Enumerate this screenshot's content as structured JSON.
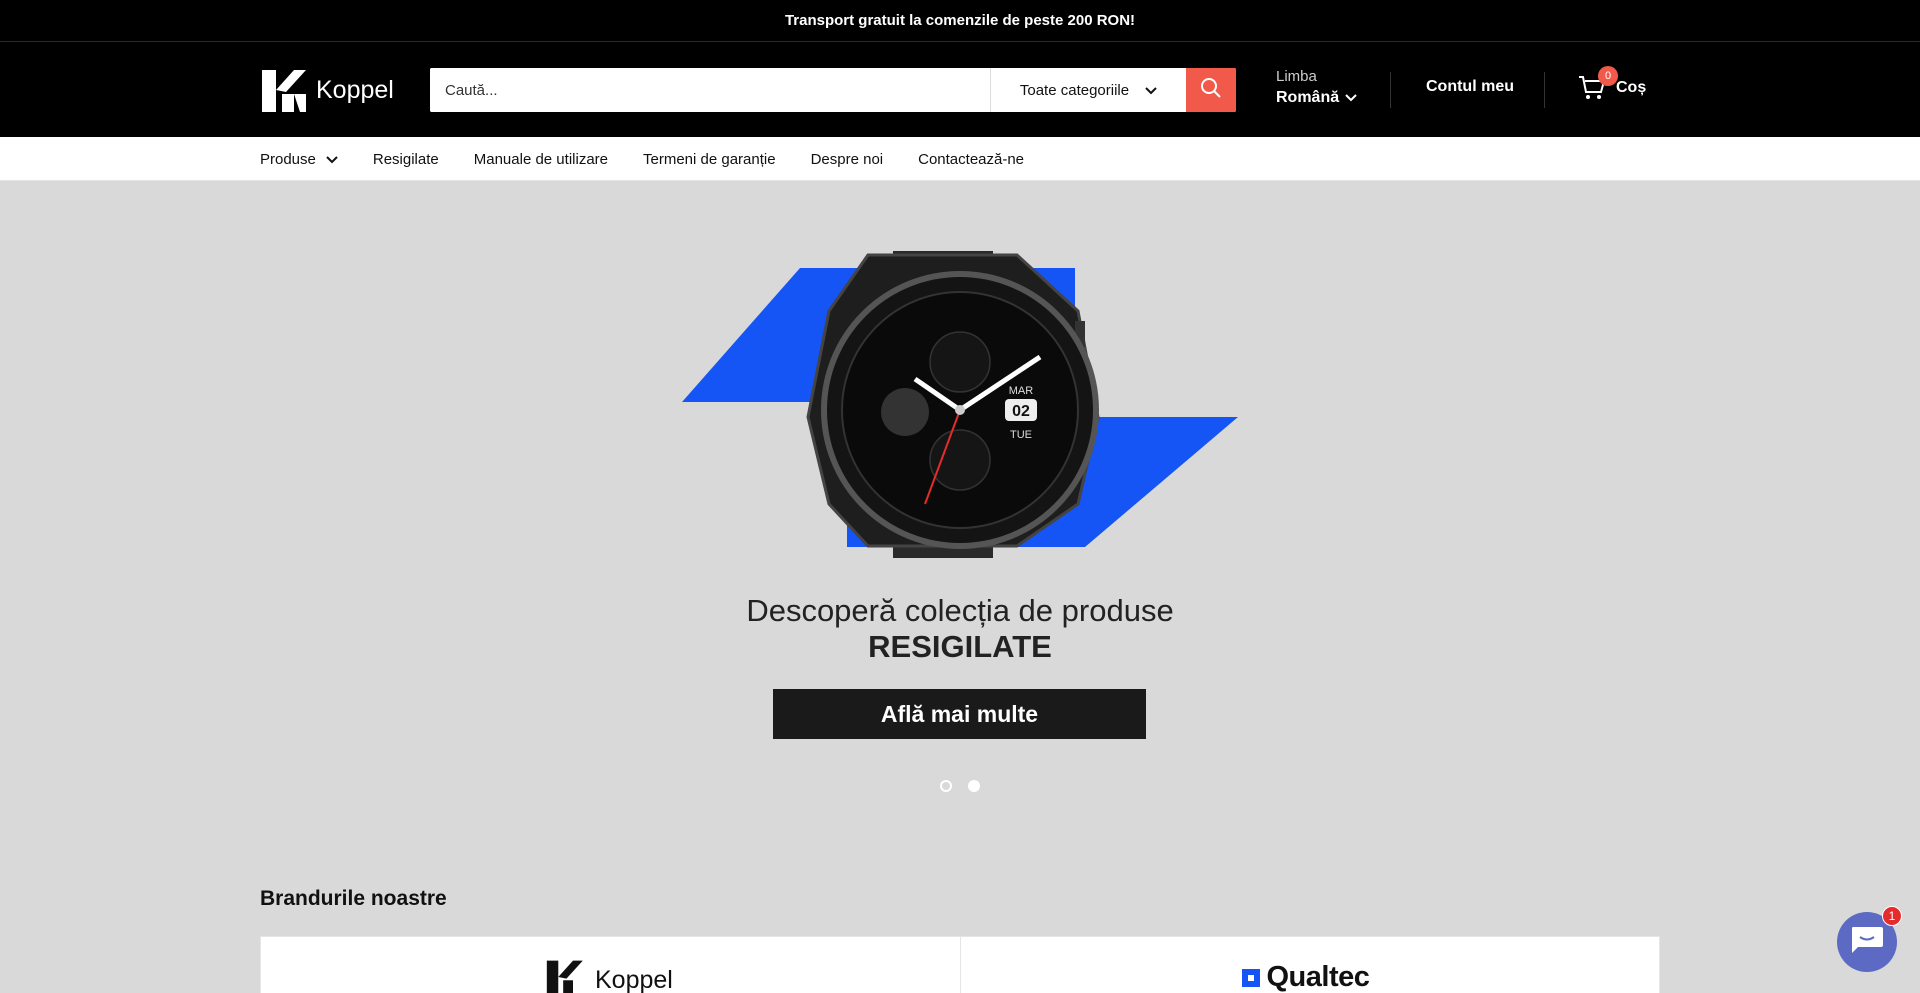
{
  "announcement": "Transport gratuit la comenzile de peste 200 RON!",
  "header": {
    "logo_text": "Koppel",
    "search": {
      "placeholder": "Caută...",
      "category": "Toate categoriile"
    },
    "language": {
      "label": "Limba",
      "value": "Română"
    },
    "account": "Contul meu",
    "cart": {
      "label": "Coș",
      "count": "0"
    }
  },
  "nav": {
    "items": [
      {
        "label": "Produse",
        "dropdown": true
      },
      {
        "label": "Resigilate"
      },
      {
        "label": "Manuale de utilizare"
      },
      {
        "label": "Termeni de garanție"
      },
      {
        "label": "Despre noi"
      },
      {
        "label": "Contactează-ne"
      }
    ]
  },
  "hero": {
    "title_line1": "Descoperă colecția de produse",
    "title_line2": "RESIGILATE",
    "cta": "Află mai multe",
    "watch": {
      "date_month": "MAR",
      "date_day": "02",
      "date_weekday": "TUE"
    },
    "slides": 2,
    "active_slide": 1
  },
  "brands": {
    "title": "Brandurile noastre",
    "items": [
      "Koppel",
      "Qualtec"
    ]
  },
  "chat": {
    "badge": "1"
  },
  "colors": {
    "accent": "#f15a4a",
    "hero_blue": "#1655f5",
    "chat": "#5c6ac4"
  }
}
